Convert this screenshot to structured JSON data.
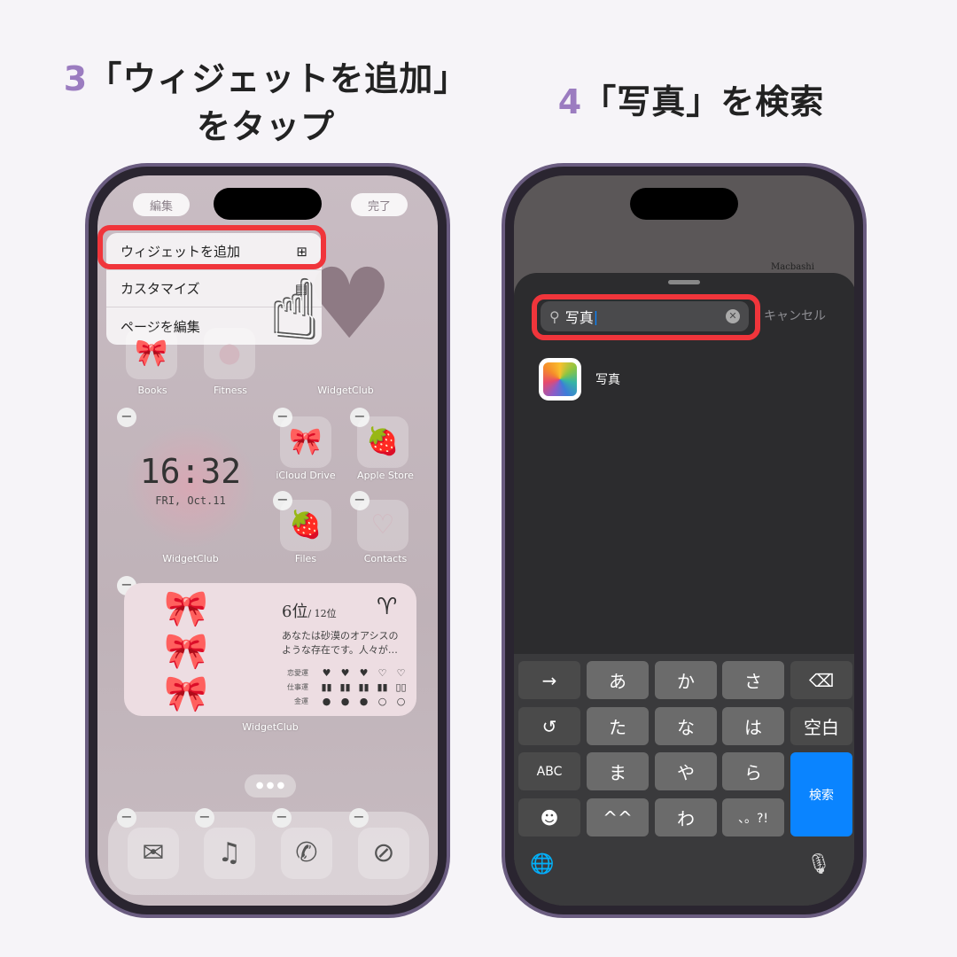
{
  "step3": {
    "number": "3",
    "line1": "「ウィジェットを追加」",
    "line2": "をタップ"
  },
  "step4": {
    "number": "4",
    "text": "「写真」を検索"
  },
  "left": {
    "edit_button": "編集",
    "done_button": "完了",
    "menu": [
      {
        "label": "ウィジェットを追加",
        "icon": "widget-add-icon"
      },
      {
        "label": "カスタマイズ",
        "icon": "customize-icon"
      },
      {
        "label": "ページを編集",
        "icon": ""
      }
    ],
    "apps_row1": [
      "Books",
      "Fitness",
      "WidgetClub"
    ],
    "clock": {
      "time": "16:32",
      "date": "FRI, Oct.11",
      "label": "WidgetClub"
    },
    "apps_grid": [
      "iCloud Drive",
      "Apple Store",
      "Files",
      "Contacts"
    ],
    "horoscope": {
      "rank": "6位",
      "total": "/ 12位",
      "sign": "♈",
      "text": "あなたは砂漠のオアシスのような存在です。人々が…",
      "rows": [
        {
          "label": "恋愛運",
          "filled": 3,
          "of": 5,
          "icon": "heart"
        },
        {
          "label": "仕事運",
          "filled": 4,
          "of": 5,
          "icon": "book"
        },
        {
          "label": "金運",
          "filled": 3,
          "of": 5,
          "icon": "coin"
        }
      ],
      "label": "WidgetClub"
    },
    "dock": [
      "mail-icon",
      "music-icon",
      "phone-icon",
      "safari-icon"
    ],
    "highlight_color": "#f0353b"
  },
  "right": {
    "search_value": "写真",
    "cancel": "キャンセル",
    "result": "写真",
    "bg_label": "Macbashi",
    "keys": [
      [
        "→",
        "あ",
        "か",
        "さ",
        "⌫"
      ],
      [
        "↺",
        "た",
        "な",
        "は",
        "空白"
      ],
      [
        "ABC",
        "ま",
        "や",
        "ら",
        "検索"
      ],
      [
        "☻",
        "^^",
        "わ",
        "、。?!"
      ]
    ],
    "search_key_color": "#0a84ff"
  }
}
